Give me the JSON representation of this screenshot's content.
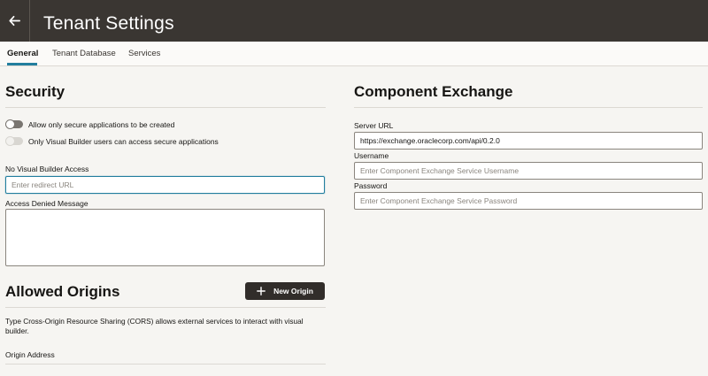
{
  "header": {
    "title": "Tenant Settings",
    "back_icon": "arrow-left-icon",
    "colors": {
      "background": "#3a3632",
      "text": "#ffffff"
    }
  },
  "tabs": [
    {
      "label": "General",
      "active": true
    },
    {
      "label": "Tenant Database",
      "active": false
    },
    {
      "label": "Services",
      "active": false
    }
  ],
  "security": {
    "title": "Security",
    "toggles": [
      {
        "label": "Allow only secure applications to be created",
        "on": false,
        "enabled": true
      },
      {
        "label": "Only Visual Builder users can access secure applications",
        "on": false,
        "enabled": false
      }
    ],
    "no_access": {
      "label": "No Visual Builder Access",
      "placeholder": "Enter redirect URL",
      "value": ""
    },
    "denied_message": {
      "label": "Access Denied Message",
      "value": ""
    }
  },
  "allowed_origins": {
    "title": "Allowed Origins",
    "new_button": "New Origin",
    "new_button_icon": "plus-icon",
    "description": "Type Cross-Origin Resource Sharing (CORS) allows external services to interact with visual builder.",
    "column_header": "Origin Address"
  },
  "component_exchange": {
    "title": "Component Exchange",
    "server_url": {
      "label": "Server URL",
      "value": "https://exchange.oraclecorp.com/api/0.2.0"
    },
    "username": {
      "label": "Username",
      "placeholder": "Enter Component Exchange Service Username",
      "value": ""
    },
    "password": {
      "label": "Password",
      "placeholder": "Enter Component Exchange Service Password",
      "value": ""
    }
  },
  "colors": {
    "accent": "#227e9e",
    "button": "#312d2a",
    "page_background": "#f6f5f2"
  }
}
